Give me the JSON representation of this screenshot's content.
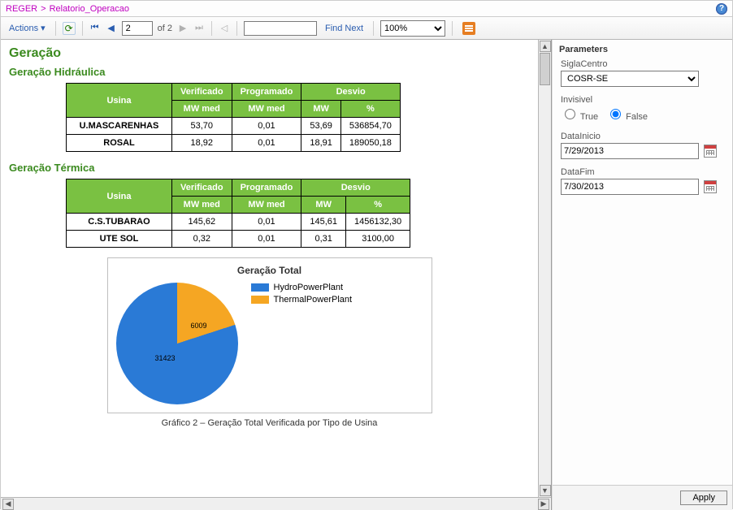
{
  "breadcrumb": {
    "root": "REGER",
    "sep": ">",
    "current": "Relatorio_Operacao"
  },
  "toolbar": {
    "actions_label": "Actions",
    "page_input": "2",
    "page_of": "of 2",
    "find_placeholder": "",
    "find_label": "Find Next",
    "zoom": "100%"
  },
  "report": {
    "title": "Geração",
    "hydro": {
      "title": "Geração Hidráulica",
      "headers": {
        "usina": "Usina",
        "verificado": "Verificado",
        "programado": "Programado",
        "desvio": "Desvio",
        "mwmed": "MW med",
        "mw": "MW",
        "pct": "%"
      },
      "rows": [
        {
          "name": "U.MASCARENHAS",
          "ver": "53,70",
          "prog": "0,01",
          "dmw": "53,69",
          "dpct": "536854,70"
        },
        {
          "name": "ROSAL",
          "ver": "18,92",
          "prog": "0,01",
          "dmw": "18,91",
          "dpct": "189050,18"
        }
      ]
    },
    "thermal": {
      "title": "Geração Térmica",
      "rows": [
        {
          "name": "C.S.TUBARAO",
          "ver": "145,62",
          "prog": "0,01",
          "dmw": "145,61",
          "dpct": "1456132,30"
        },
        {
          "name": "UTE SOL",
          "ver": "0,32",
          "prog": "0,01",
          "dmw": "0,31",
          "dpct": "3100,00"
        }
      ]
    },
    "chart_caption": "Gráfico 2 – Geração Total Verificada por Tipo de Usina"
  },
  "chart_data": {
    "type": "pie",
    "title": "Geração Total",
    "series": [
      {
        "name": "HydroPowerPlant",
        "value": 31423,
        "color": "#2a7ad6"
      },
      {
        "name": "ThermalPowerPlant",
        "value": 6009,
        "color": "#f5a623"
      }
    ],
    "labels": {
      "big": "31423",
      "small": "6009"
    }
  },
  "parameters": {
    "title": "Parameters",
    "sigla_label": "SiglaCentro",
    "sigla_value": "COSR-SE",
    "invisivel_label": "Invisivel",
    "true_label": "True",
    "false_label": "False",
    "invisivel_value": "False",
    "datainicio_label": "DataInicio",
    "datainicio_value": "7/29/2013",
    "datafim_label": "DataFim",
    "datafim_value": "7/30/2013",
    "apply_label": "Apply"
  }
}
